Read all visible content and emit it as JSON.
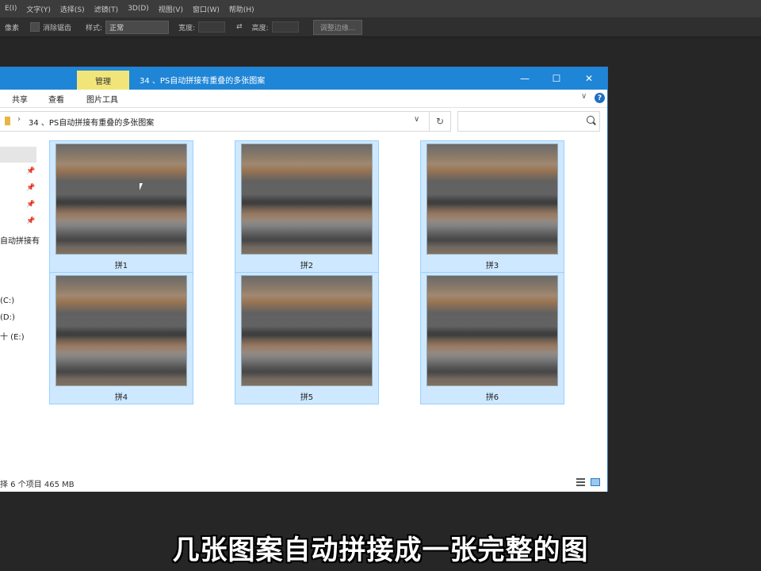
{
  "ps_menu": [
    "E(I)",
    "文字(Y)",
    "选择(S)",
    "滤镜(T)",
    "3D(D)",
    "视图(V)",
    "窗口(W)",
    "帮助(H)"
  ],
  "ps_options": {
    "left_label": "像素",
    "antialias": "消除锯齿",
    "style_label": "样式:",
    "style_value": "正常",
    "width_label": "宽度:",
    "height_label": "高度:",
    "refine_button": "调整边缘..."
  },
  "window": {
    "manage_tab": "管理",
    "title": "34 、PS自动拼接有重叠的多张图案",
    "minimize": "—",
    "maximize": "☐",
    "close": "✕"
  },
  "ribbon": {
    "share": "共享",
    "view": "查看",
    "picture_tools": "图片工具",
    "collapse": "∨",
    "help": "?"
  },
  "address": {
    "separator": "›",
    "path": "34 、PS自动拼接有重叠的多张图案",
    "dropdown": "∨",
    "refresh": "↻"
  },
  "nav": {
    "items": [
      "自动拼接有",
      "(C:)",
      "(D:)",
      "十 (E:)"
    ]
  },
  "files": [
    {
      "name": "拼1"
    },
    {
      "name": "拼2"
    },
    {
      "name": "拼3"
    },
    {
      "name": "拼4"
    },
    {
      "name": "拼5"
    },
    {
      "name": "拼6"
    }
  ],
  "status": {
    "text": "择 6 个项目  465 MB"
  },
  "subtitle": "几张图案自动拼接成一张完整的图",
  "colors": {
    "titlebar": "#1f85d6",
    "manage_tab": "#f1e57a",
    "selection": "#cde8ff",
    "ps_background": "#262626"
  }
}
